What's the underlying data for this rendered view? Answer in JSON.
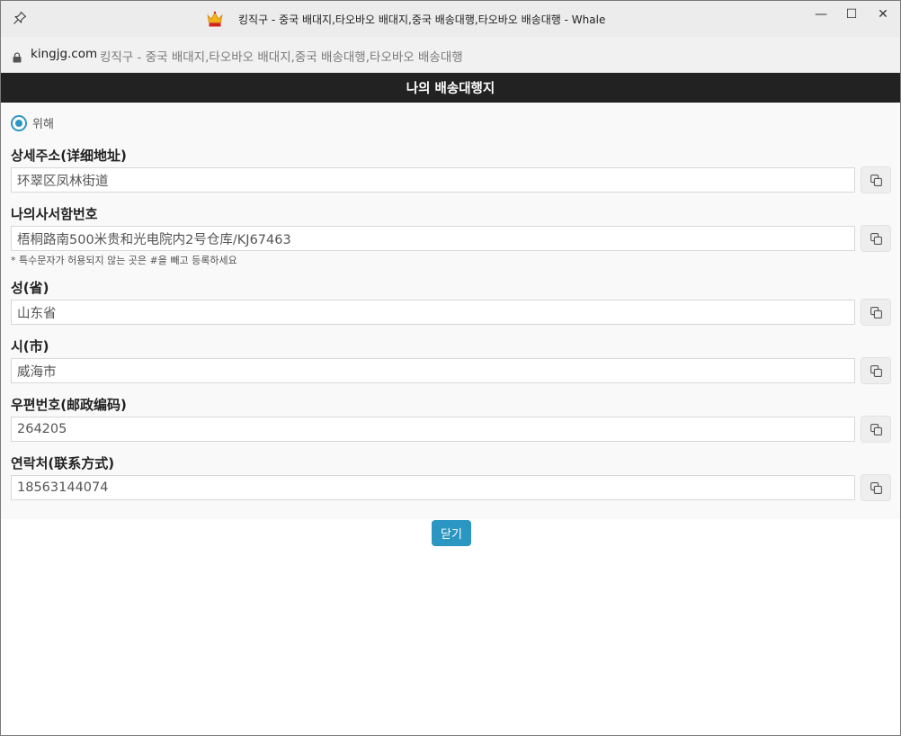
{
  "window": {
    "title": "킹직구 - 중국 배대지,타오바오 배대지,중국 배송대행,타오바오 배송대행 - Whale",
    "minimize_glyph": "—",
    "maximize_glyph": "☐",
    "close_glyph": "✕"
  },
  "addressbar": {
    "host": "kingjg.com",
    "page_title": "킹직구 - 중국 배대지,타오바오 배대지,중국 배송대행,타오바오 배송대행"
  },
  "modal": {
    "title": "나의 배송대행지",
    "radio_label": "위해",
    "radio_selected": true,
    "note": "* 특수문자가 허용되지 않는 곳은 #을 빼고 등록하세요",
    "close_label": "닫기",
    "accent_color": "#2a96c1",
    "fields": [
      {
        "label": "상세주소(详细地址)",
        "value": "环翠区凤林街道"
      },
      {
        "label": "나의사서함번호",
        "value": "梧桐路南500米贵和光电院内2号仓库/KJ67463"
      },
      {
        "label": "성(省)",
        "value": "山东省"
      },
      {
        "label": "시(市)",
        "value": "威海市"
      },
      {
        "label": "우편번호(邮政编码)",
        "value": "264205"
      },
      {
        "label": "연락처(联系方式)",
        "value": "18563144074"
      }
    ]
  }
}
